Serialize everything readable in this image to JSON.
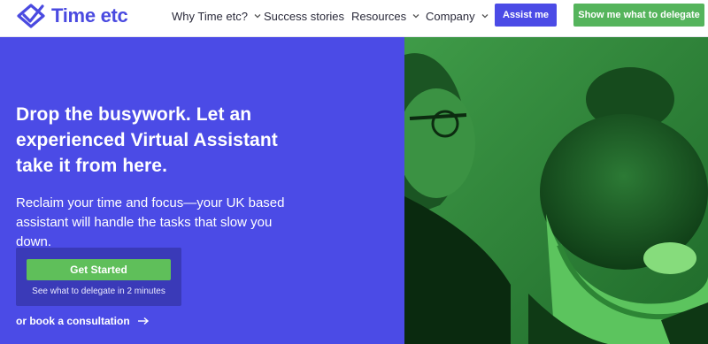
{
  "brand": {
    "logo_text": "Time etc",
    "logo_icon": "checkmark-diamond-icon",
    "accent": "#4b4be6",
    "green": "#55b45c"
  },
  "nav": {
    "items": [
      {
        "label": "Why Time etc?",
        "has_dropdown": true
      },
      {
        "label": "Success stories",
        "has_dropdown": false
      },
      {
        "label": "Resources",
        "has_dropdown": true
      },
      {
        "label": "Company",
        "has_dropdown": true
      }
    ],
    "assist_label": "Assist me",
    "delegate_label": "Show me what to delegate"
  },
  "hero": {
    "headline": "Drop the busywork. Let an experienced Virtual Assistant take it from here.",
    "subhead": "Reclaim your time and focus—your UK based assistant will handle the tasks that slow you down.",
    "cta_label": "Get Started",
    "cta_caption": "See what to delegate in 2 minutes",
    "consult_label": "or book a consultation",
    "consult_icon": "arrow-right-icon"
  },
  "photo": {
    "description_icon": "team-photo-image"
  }
}
